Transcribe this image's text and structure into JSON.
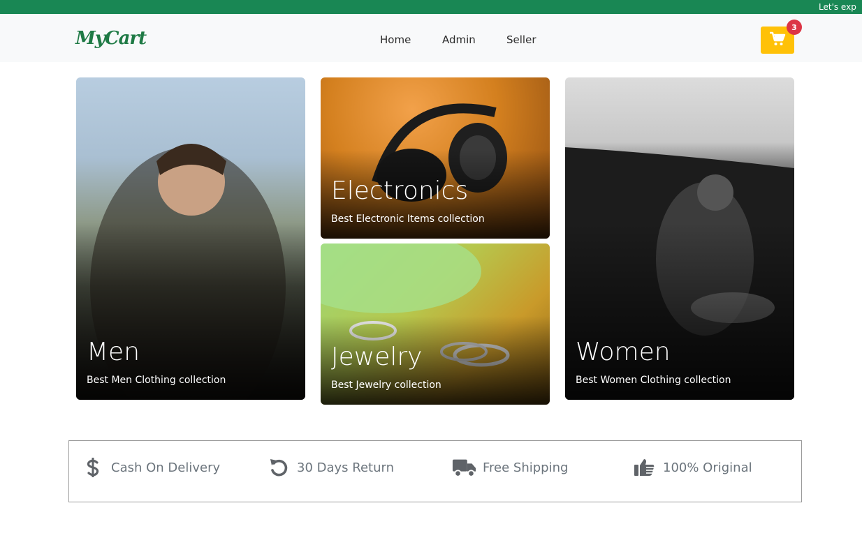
{
  "ticker": {
    "text": "Let's exp"
  },
  "navbar": {
    "brand": "MyCart",
    "links": [
      "Home",
      "Admin",
      "Seller"
    ],
    "cart_count": "3",
    "cart_color": "#ffc107",
    "badge_color": "#dc3545"
  },
  "categories": [
    {
      "title": "Men",
      "subtitle": "Best Men Clothing collection"
    },
    {
      "title": "Electronics",
      "subtitle": "Best Electronic Items collection"
    },
    {
      "title": "Jewelry",
      "subtitle": "Best Jewelry collection"
    },
    {
      "title": "Women",
      "subtitle": "Best Women Clothing collection"
    }
  ],
  "features": [
    {
      "icon": "dollar-icon",
      "label": "Cash On Delivery"
    },
    {
      "icon": "undo-icon",
      "label": "30 Days Return"
    },
    {
      "icon": "truck-icon",
      "label": "Free Shipping"
    },
    {
      "icon": "thumbs-up-icon",
      "label": "100% Original"
    }
  ],
  "colors": {
    "brand_green": "#198754"
  }
}
